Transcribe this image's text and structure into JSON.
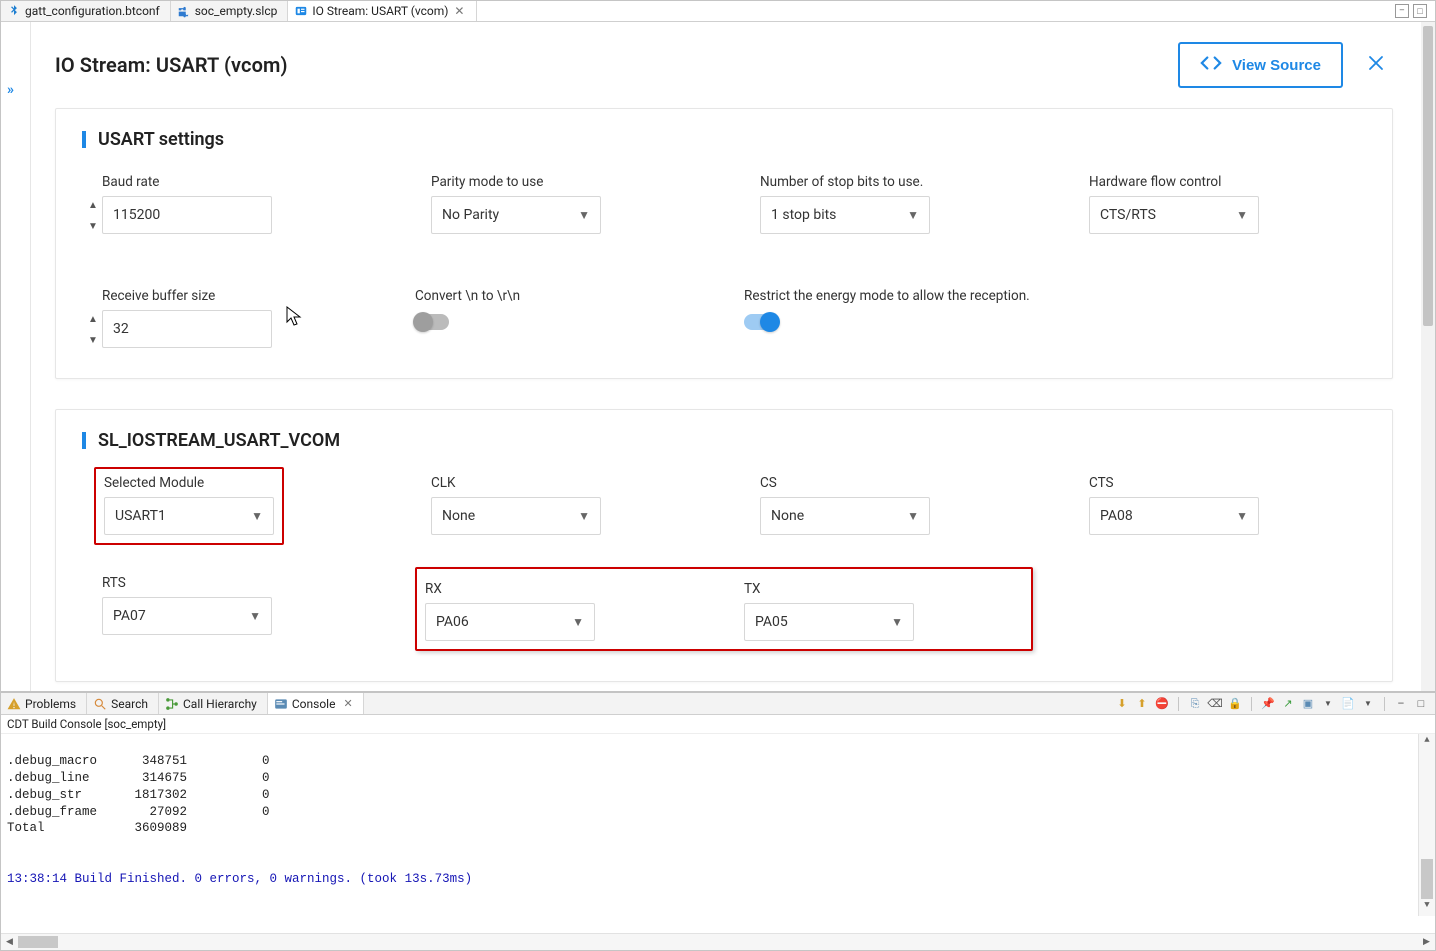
{
  "tabs": {
    "t0": "gatt_configuration.btconf",
    "t1": "soc_empty.slcp",
    "t2": "IO Stream: USART (vcom)"
  },
  "header": {
    "title": "IO Stream: USART (vcom)",
    "view_source": "View Source"
  },
  "usart": {
    "title": "USART settings",
    "baud_label": "Baud rate",
    "baud_value": "115200",
    "parity_label": "Parity mode to use",
    "parity_value": "No Parity",
    "stopbits_label": "Number of stop bits to use.",
    "stopbits_value": "1 stop bits",
    "flow_label": "Hardware flow control",
    "flow_value": "CTS/RTS",
    "rxbuf_label": "Receive buffer size",
    "rxbuf_value": "32",
    "convert_label": "Convert \\n to \\r\\n",
    "restrict_label": "Restrict the energy mode to allow the reception."
  },
  "vcom": {
    "title": "SL_IOSTREAM_USART_VCOM",
    "selmod_label": "Selected Module",
    "selmod_value": "USART1",
    "clk_label": "CLK",
    "clk_value": "None",
    "cs_label": "CS",
    "cs_value": "None",
    "cts_label": "CTS",
    "cts_value": "PA08",
    "rts_label": "RTS",
    "rts_value": "PA07",
    "rx_label": "RX",
    "rx_value": "PA06",
    "tx_label": "TX",
    "tx_value": "PA05"
  },
  "views": {
    "problems": "Problems",
    "search": "Search",
    "callhier": "Call Hierarchy",
    "console": "Console"
  },
  "console": {
    "header": "CDT Build Console [soc_empty]",
    "l0": ".debug_macro      348751          0",
    "l1": ".debug_line       314675          0",
    "l2": ".debug_str       1817302          0",
    "l3": ".debug_frame       27092          0",
    "l4": "Total            3609089",
    "l5": "",
    "l6": "",
    "l7": "13:38:14 Build Finished. 0 errors, 0 warnings. (took 13s.73ms)"
  }
}
